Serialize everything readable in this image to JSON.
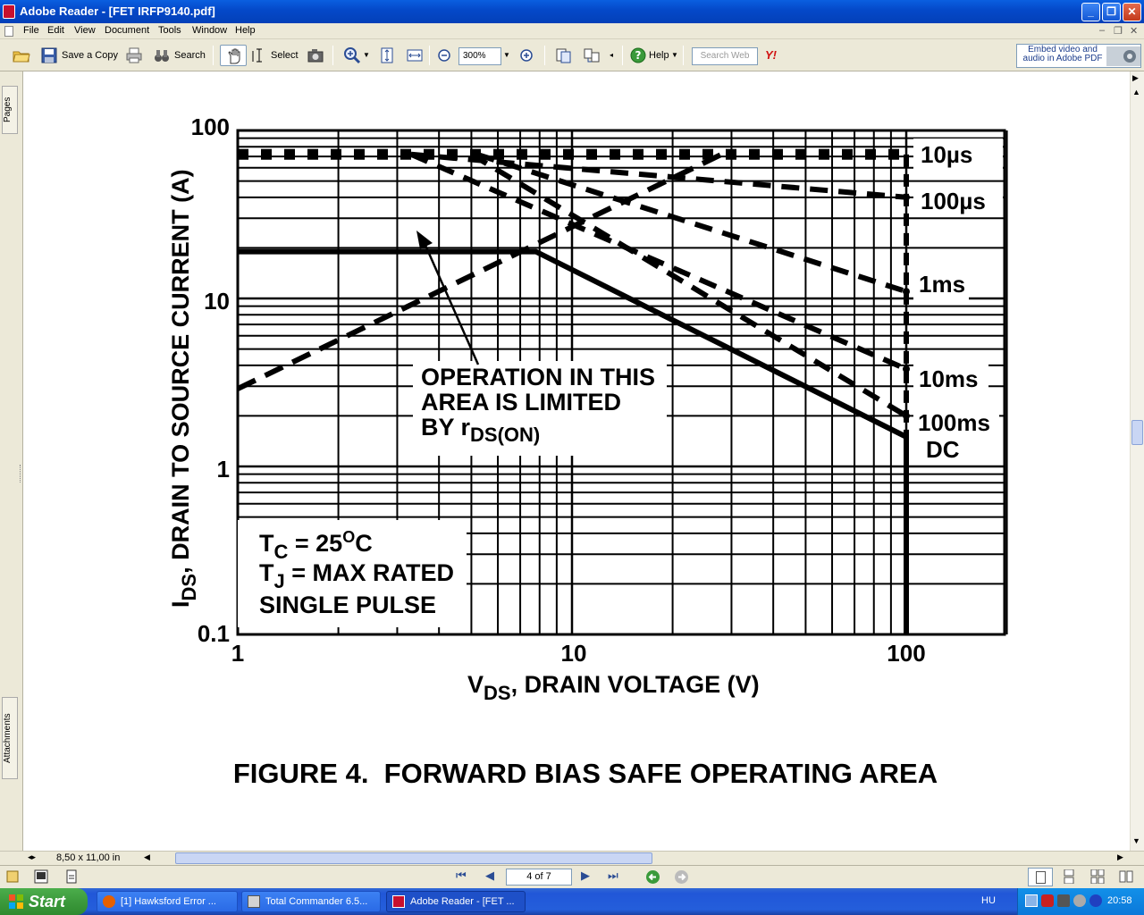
{
  "window": {
    "title": "Adobe Reader - [FET IRFP9140.pdf]"
  },
  "menu": [
    "File",
    "Edit",
    "View",
    "Document",
    "Tools",
    "Window",
    "Help"
  ],
  "toolbar": {
    "save_copy_label": "Save a Copy",
    "search_label": "Search",
    "select_label": "Select",
    "zoom_value": "300%",
    "help_label": "Help",
    "search_web_placeholder": "Search Web",
    "promo_text_1": "Embed video and",
    "promo_text_2": "audio in Adobe PDF"
  },
  "side_tabs": {
    "pages": "Pages",
    "attachments": "Attachments"
  },
  "status": {
    "page_size": "8,50 x 11,00 in",
    "page_indicator": "4 of 7"
  },
  "taskbar": {
    "start_label": "Start",
    "tasks": [
      "[1] Hawksford Error ...",
      "Total Commander 6.5...",
      "Adobe Reader - [FET ..."
    ],
    "language": "HU",
    "clock": "20:58"
  },
  "figure": {
    "caption": "FIGURE 4.  FORWARD BIAS SAFE OPERATING AREA",
    "y_ticks": [
      "100",
      "10",
      "1",
      "0.1"
    ],
    "x_ticks": [
      "1",
      "10",
      "100"
    ],
    "ylabel_main": "I",
    "ylabel_sub": "DS",
    "ylabel_rest": ", DRAIN TO SOURCE CURRENT (A)",
    "xlabel_main": "V",
    "xlabel_sub": "DS",
    "xlabel_rest": ", DRAIN VOLTAGE (V)",
    "pulse_labels": [
      "10µs",
      "100µs",
      "1ms",
      "10ms",
      "100ms",
      "DC"
    ],
    "annot_line1": "OPERATION IN THIS",
    "annot_line2": "AREA IS LIMITED",
    "annot_line3_main": "BY r",
    "annot_line3_sub": "DS(ON)",
    "cond1_main": "T",
    "cond1_sub": "C",
    "cond1_rest": " = 25",
    "cond1_sup": "O",
    "cond1_end": "C",
    "cond2_main": "T",
    "cond2_sub": "J",
    "cond2_rest": " = MAX RATED",
    "cond3": "SINGLE PULSE"
  },
  "chart_data": {
    "type": "line",
    "title": "FIGURE 4.  FORWARD BIAS SAFE OPERATING AREA",
    "xlabel": "VDS, DRAIN VOLTAGE (V)",
    "ylabel": "IDS, DRAIN TO SOURCE CURRENT (A)",
    "xscale": "log",
    "yscale": "log",
    "xlim": [
      1,
      200
    ],
    "ylim": [
      0.1,
      100
    ],
    "grid": true,
    "series": [
      {
        "name": "DC",
        "x": [
          1,
          7.8,
          100,
          100
        ],
        "y": [
          19,
          19,
          1.5,
          0.1
        ]
      },
      {
        "name": "10µs",
        "x": [
          1,
          100
        ],
        "y": [
          72,
          72
        ]
      },
      {
        "name": "100µs",
        "x": [
          3.3,
          100
        ],
        "y": [
          72,
          40
        ]
      },
      {
        "name": "1ms",
        "x": [
          5.2,
          100
        ],
        "y": [
          72,
          11
        ]
      },
      {
        "name": "10ms",
        "x": [
          3.3,
          100
        ],
        "y": [
          72,
          3.8
        ]
      },
      {
        "name": "100ms",
        "x": [
          5,
          100
        ],
        "y": [
          72,
          2
        ]
      },
      {
        "name": "rDS(ON)",
        "x": [
          1,
          28
        ],
        "y": [
          2.9,
          72
        ]
      }
    ]
  }
}
